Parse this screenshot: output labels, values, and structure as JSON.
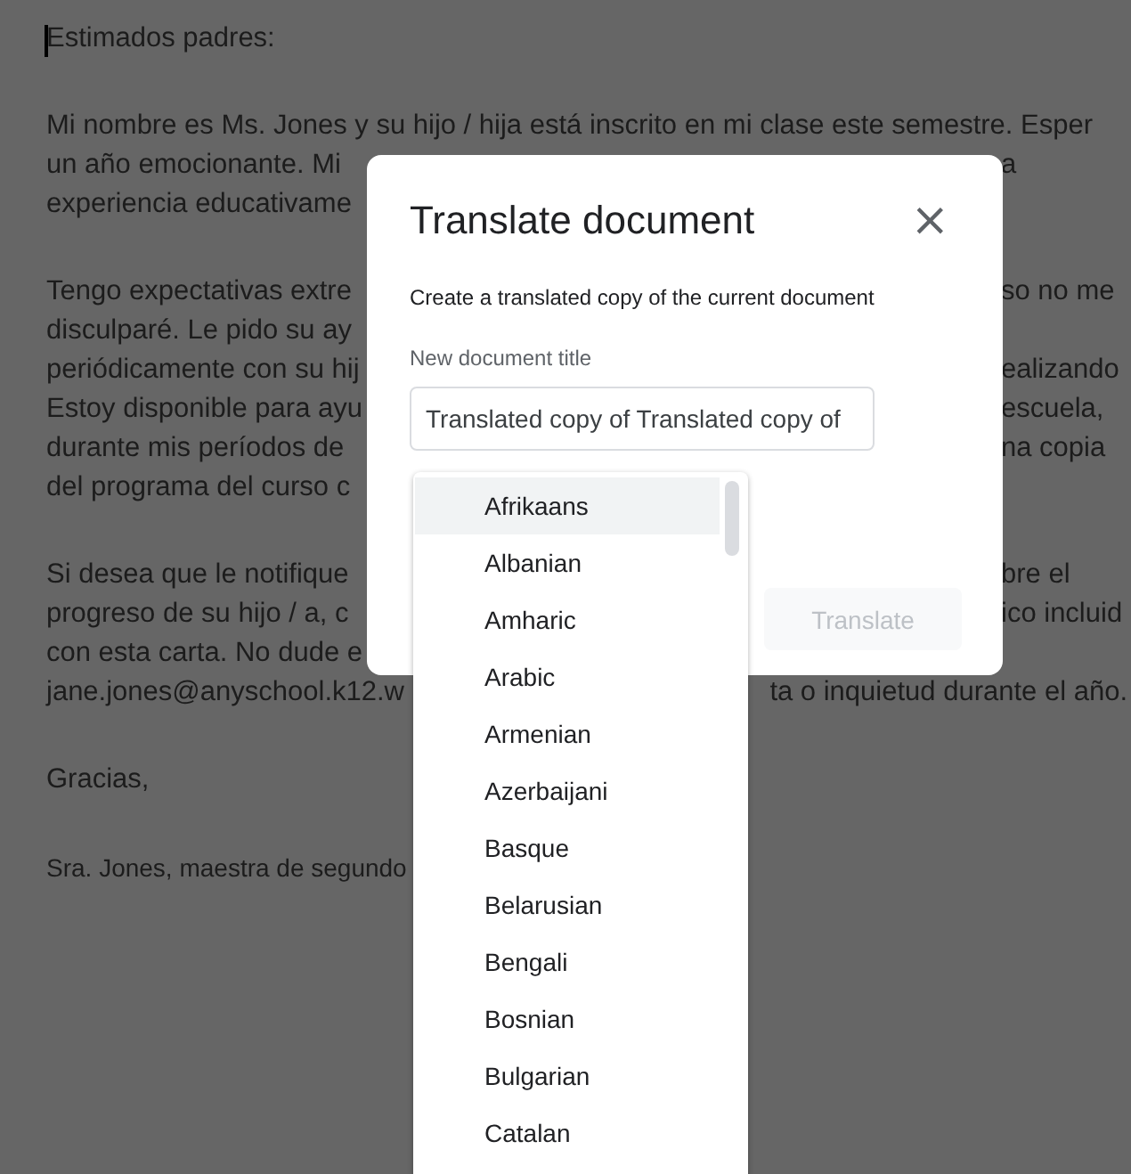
{
  "document": {
    "paragraphs": [
      {
        "lines": [
          {
            "left": "Estimados padres:"
          }
        ]
      },
      {
        "lines": [
          {
            "left": "Mi nombre es Ms. Jones y su hijo / hija está inscrito en mi clase este semestre. Esper"
          },
          {
            "left": "un año emocionante. Mi",
            "right": "a"
          },
          {
            "left": "experiencia educativame"
          }
        ]
      },
      {
        "lines": [
          {
            "left": "Tengo expectativas extre",
            "right": "so no me"
          },
          {
            "left": "disculparé. Le pido su ay"
          },
          {
            "left": "periódicamente con su hij",
            "right": "ealizando"
          },
          {
            "left": "Estoy disponible para ayu",
            "right": "escuela,"
          },
          {
            "left": "durante mis períodos de",
            "right": "na copia"
          },
          {
            "left": "del programa del curso c"
          }
        ]
      },
      {
        "lines": [
          {
            "left": "Si desea que le notifique",
            "right": "bre el"
          },
          {
            "left": "progreso de su hijo / a, c",
            "right": "ico incluid"
          },
          {
            "left": "con esta carta. No dude e"
          },
          {
            "left": "jane.jones@anyschool.k12.w",
            "right": "ta o inquietud durante el año."
          }
        ]
      },
      {
        "lines": [
          {
            "left": "Gracias,"
          }
        ]
      },
      {
        "kind": "signature",
        "lines": [
          {
            "left": "Sra. Jones, maestra de segundo"
          }
        ]
      }
    ]
  },
  "dialog": {
    "title": "Translate document",
    "close": "×",
    "subtitle": "Create a translated copy of the current document",
    "field_label": "New document title",
    "field_value": "Translated copy of Translated copy of",
    "button": {
      "label": "Translate",
      "disabled": true
    }
  },
  "language_list": [
    {
      "label": "Afrikaans",
      "selected": true
    },
    {
      "label": "Albanian",
      "selected": false
    },
    {
      "label": "Amharic",
      "selected": false
    },
    {
      "label": "Arabic",
      "selected": false
    },
    {
      "label": "Armenian",
      "selected": false
    },
    {
      "label": "Azerbaijani",
      "selected": false
    },
    {
      "label": "Basque",
      "selected": false
    },
    {
      "label": "Belarusian",
      "selected": false
    },
    {
      "label": "Bengali",
      "selected": false
    },
    {
      "label": "Bosnian",
      "selected": false
    },
    {
      "label": "Bulgarian",
      "selected": false
    },
    {
      "label": "Catalan",
      "selected": false
    }
  ]
}
